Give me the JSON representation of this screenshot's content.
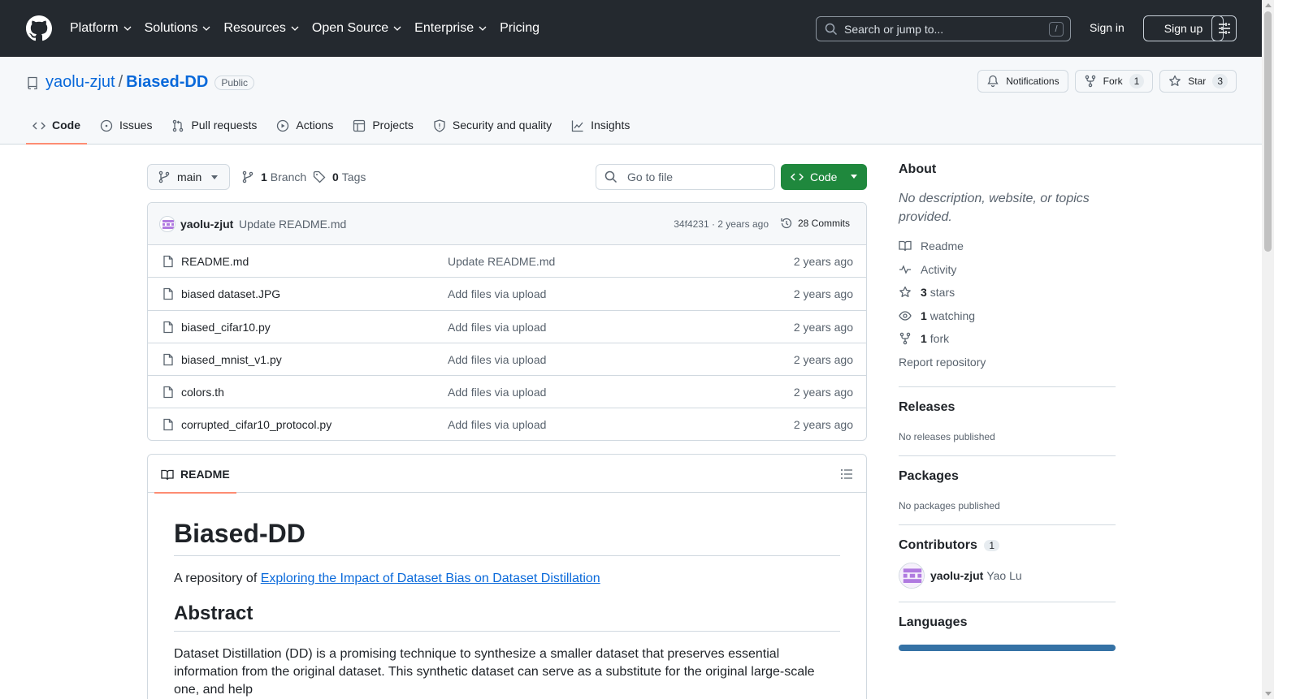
{
  "header": {
    "nav": [
      "Platform",
      "Solutions",
      "Resources",
      "Open Source",
      "Enterprise",
      "Pricing"
    ],
    "search_placeholder": "Search or jump to...",
    "search_shortcut": "/",
    "sign_in": "Sign in",
    "sign_up": "Sign up"
  },
  "repo": {
    "owner": "yaolu-zjut",
    "separator": "/",
    "name": "Biased-DD",
    "visibility": "Public",
    "notifications_label": "Notifications",
    "fork_label": "Fork",
    "fork_count": "1",
    "star_label": "Star",
    "star_count": "3"
  },
  "tabs": [
    "Code",
    "Issues",
    "Pull requests",
    "Actions",
    "Projects",
    "Security and quality",
    "Insights"
  ],
  "file_nav": {
    "branch": "main",
    "branch_count": "1",
    "branch_label": "Branch",
    "tag_count": "0",
    "tag_label": "Tags",
    "go_to_file": "Go to file",
    "code_button": "Code"
  },
  "commit": {
    "author": "yaolu-zjut",
    "message": "Update README.md",
    "meta": "34f4231 · 2 years ago",
    "count_label": "28 Commits"
  },
  "files": [
    {
      "name": "README.md",
      "message": "Update README.md",
      "age": "2 years ago"
    },
    {
      "name": "biased dataset.JPG",
      "message": "Add files via upload",
      "age": "2 years ago"
    },
    {
      "name": "biased_cifar10.py",
      "message": "Add files via upload",
      "age": "2 years ago"
    },
    {
      "name": "biased_mnist_v1.py",
      "message": "Add files via upload",
      "age": "2 years ago"
    },
    {
      "name": "colors.th",
      "message": "Add files via upload",
      "age": "2 years ago"
    },
    {
      "name": "corrupted_cifar10_protocol.py",
      "message": "Add files via upload",
      "age": "2 years ago"
    }
  ],
  "readme": {
    "tab_label": "README",
    "title": "Biased-DD",
    "intro_prefix": "A repository of ",
    "intro_link": "Exploring the Impact of Dataset Bias on Dataset Distillation",
    "abstract_heading": "Abstract",
    "abstract_text": "Dataset Distillation (DD) is a promising technique to synthesize a smaller dataset that preserves essential information from the original dataset. This synthetic dataset can serve as a substitute for the original large-scale one, and help"
  },
  "sidebar": {
    "about_heading": "About",
    "about_desc": "No description, website, or topics provided.",
    "readme": "Readme",
    "activity": "Activity",
    "stars_count": "3",
    "stars_label": "stars",
    "watching_count": "1",
    "watching_label": "watching",
    "forks_count": "1",
    "forks_label": "fork",
    "report": "Report repository",
    "releases_heading": "Releases",
    "releases_text": "No releases published",
    "packages_heading": "Packages",
    "packages_text": "No packages published",
    "contributors_heading": "Contributors",
    "contributors_count": "1",
    "contributor_login": "yaolu-zjut",
    "contributor_name": "Yao Lu",
    "languages_heading": "Languages"
  },
  "colors": {
    "header_bg": "#24292f",
    "link": "#0969da",
    "code_button": "#1f883d",
    "tab_underline": "#fd8c73",
    "language_python": "#3572a5"
  }
}
